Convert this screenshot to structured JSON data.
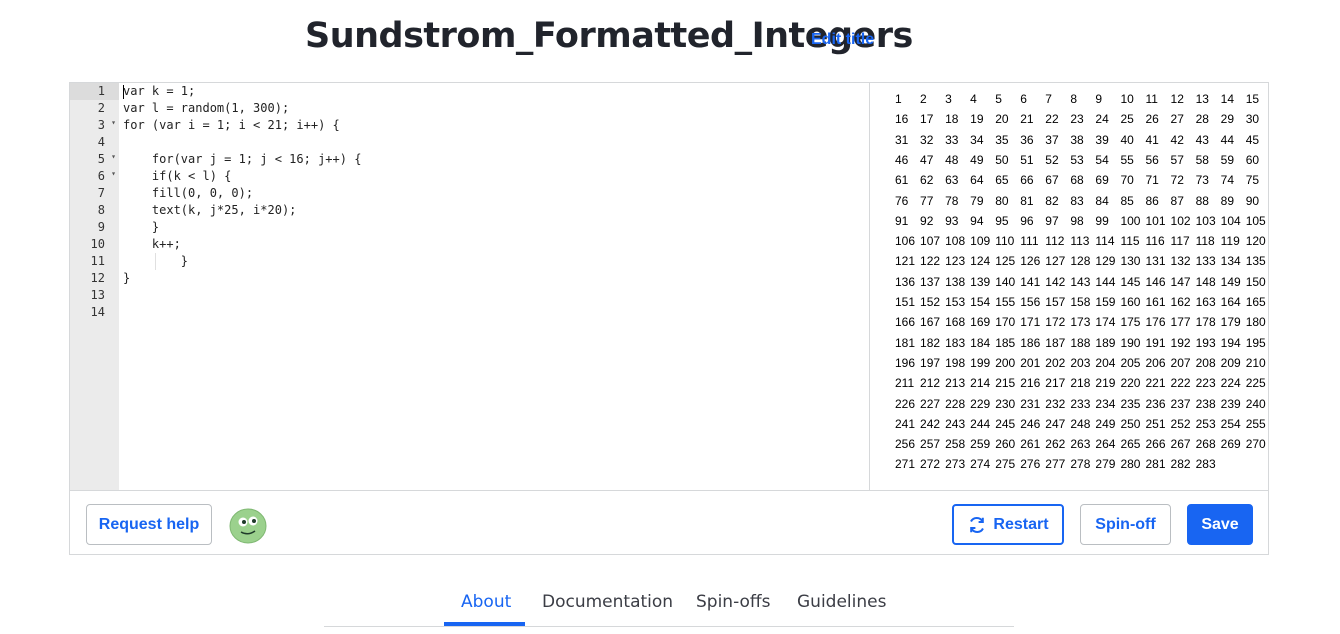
{
  "header": {
    "title": "Sundstrom_Formatted_Integers",
    "edit_title_label": "Edit title"
  },
  "editor": {
    "gutter": [
      {
        "n": "1",
        "fold": ""
      },
      {
        "n": "2",
        "fold": ""
      },
      {
        "n": "3",
        "fold": "▾"
      },
      {
        "n": "4",
        "fold": ""
      },
      {
        "n": "5",
        "fold": "▾"
      },
      {
        "n": "6",
        "fold": "▾"
      },
      {
        "n": "7",
        "fold": ""
      },
      {
        "n": "8",
        "fold": ""
      },
      {
        "n": "9",
        "fold": ""
      },
      {
        "n": "10",
        "fold": ""
      },
      {
        "n": "11",
        "fold": ""
      },
      {
        "n": "12",
        "fold": ""
      },
      {
        "n": "13",
        "fold": ""
      },
      {
        "n": "14",
        "fold": ""
      }
    ],
    "code": [
      "var k = 1;",
      "var l = random(1, 300);",
      "for (var i = 1; i < 21; i++) {",
      "",
      "    for(var j = 1; j < 16; j++) {",
      "    if(k < l) {",
      "    fill(0, 0, 0);",
      "    text(k, j*25, i*20);",
      "    }",
      "    k++;",
      "        }",
      "}",
      "",
      ""
    ]
  },
  "output": {
    "first": 1,
    "last": 283,
    "per_row": 15
  },
  "toolbar": {
    "request_help_label": "Request help",
    "restart_label": "Restart",
    "spinoff_label": "Spin-off",
    "save_label": "Save"
  },
  "tabs": [
    {
      "label": "About",
      "active": true
    },
    {
      "label": "Documentation",
      "active": false
    },
    {
      "label": "Spin-offs",
      "active": false
    },
    {
      "label": "Guidelines",
      "active": false
    }
  ],
  "colors": {
    "accent": "#1865f2",
    "avatar": "#9bd18d"
  }
}
